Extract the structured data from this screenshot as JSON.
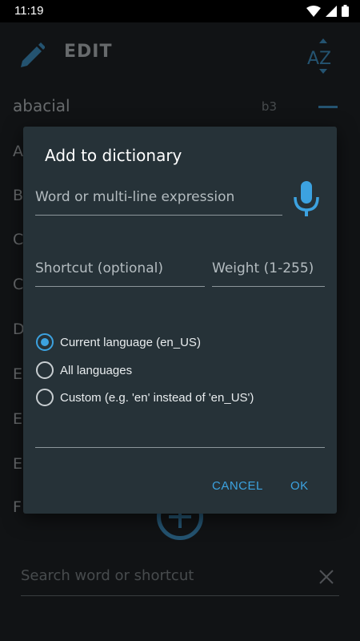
{
  "status_bar": {
    "time": "11:19"
  },
  "toolbar": {
    "title": "EDIT"
  },
  "word_list": {
    "first_item": {
      "word": "abacial",
      "shortcut": "b3"
    },
    "partial_letters": [
      "A",
      "B",
      "C",
      "C",
      "D",
      "E",
      "E",
      "E",
      "F"
    ]
  },
  "search": {
    "placeholder": "Search word or shortcut"
  },
  "dialog": {
    "title": "Add to dictionary",
    "word_placeholder": "Word or multi-line expression",
    "shortcut_placeholder": "Shortcut (optional)",
    "weight_placeholder": "Weight (1-255)",
    "radio_options": [
      {
        "label": "Current language (en_US)",
        "checked": true
      },
      {
        "label": "All languages",
        "checked": false
      },
      {
        "label": "Custom (e.g. 'en' instead of 'en_US')",
        "checked": false
      }
    ],
    "cancel_label": "CANCEL",
    "ok_label": "OK"
  },
  "colors": {
    "accent": "#3ca2e0",
    "dialog_bg": "#263238",
    "background": "#111315"
  }
}
